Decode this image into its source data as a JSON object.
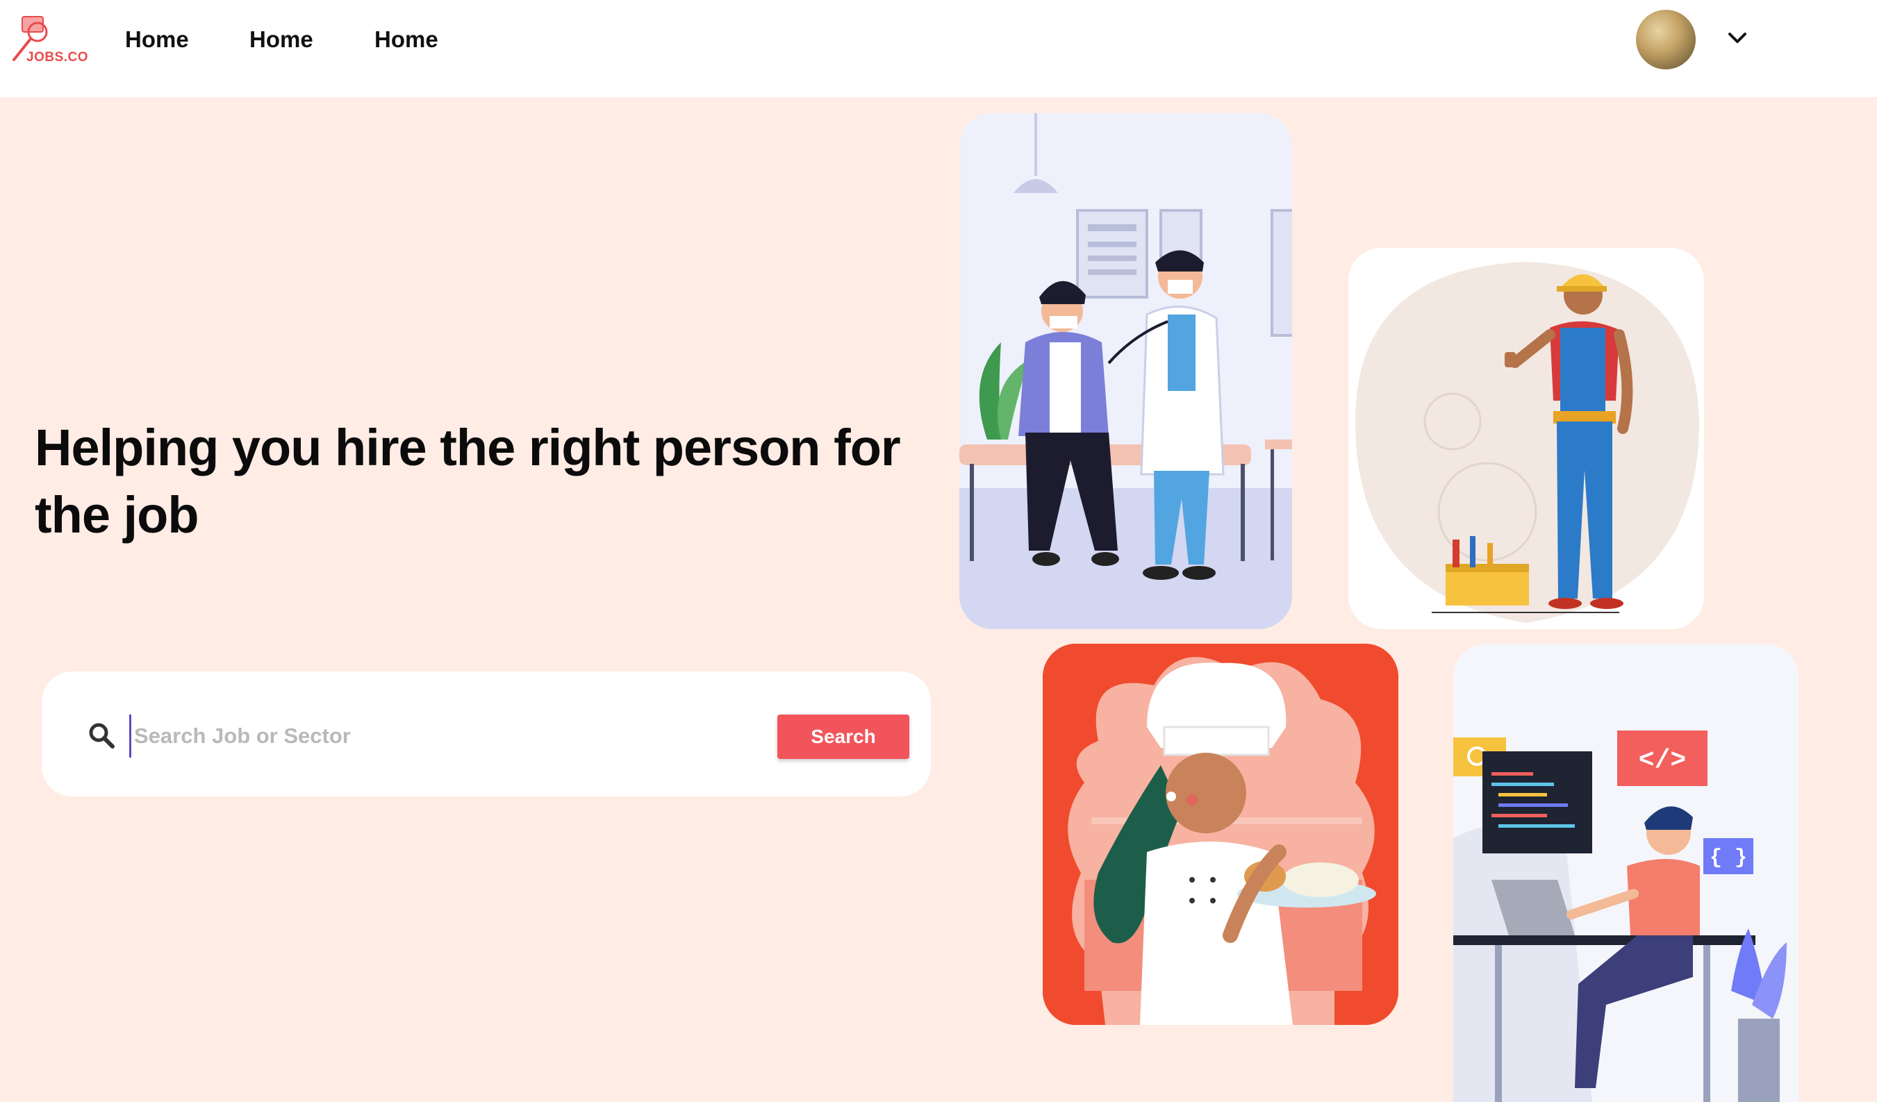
{
  "brand": {
    "logo_text": "JOBS.CO",
    "accent_color": "#f2545b"
  },
  "nav": {
    "links": [
      {
        "label": "Home"
      },
      {
        "label": "Home"
      },
      {
        "label": "Home"
      }
    ],
    "avatar_icon": "user-avatar",
    "dropdown_icon": "chevron-down-icon"
  },
  "hero": {
    "title": "Helping you hire the right person for the job"
  },
  "search": {
    "placeholder": "Search Job or Sector",
    "button_label": "Search",
    "icon": "search-icon"
  },
  "illustrations": {
    "doctor": {
      "icon": "doctor-patient-illustration"
    },
    "worker": {
      "icon": "construction-worker-illustration"
    },
    "chef": {
      "icon": "chef-illustration"
    },
    "developer": {
      "icon": "developer-illustration",
      "code_tag": "</>",
      "braces": "{ }"
    }
  }
}
